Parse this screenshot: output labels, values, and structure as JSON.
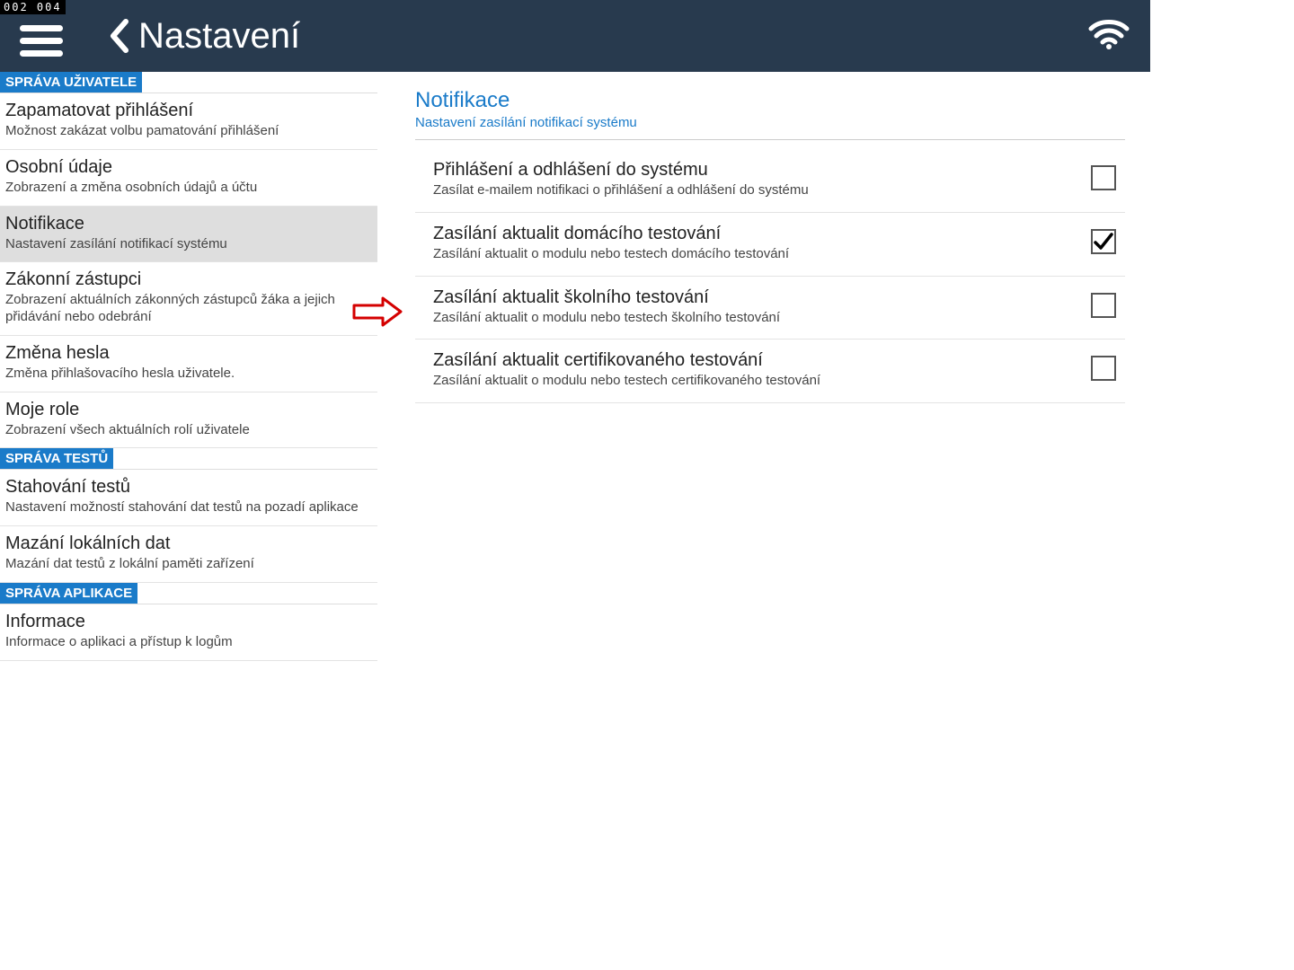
{
  "status_bar": {
    "time": "002  004"
  },
  "header": {
    "title": "Nastavení"
  },
  "sidebar": {
    "sections": [
      {
        "header": "SPRÁVA UŽIVATELE",
        "items": [
          {
            "title": "Zapamatovat přihlášení",
            "sub": "Možnost zakázat volbu pamatování přihlášení",
            "selected": false
          },
          {
            "title": "Osobní údaje",
            "sub": "Zobrazení a změna osobních údajů a účtu",
            "selected": false
          },
          {
            "title": "Notifikace",
            "sub": "Nastavení zasílání notifikací systému",
            "selected": true
          },
          {
            "title": "Zákonní zástupci",
            "sub": "Zobrazení aktuálních zákonných zástupců žáka a jejich přidávání nebo odebrání",
            "selected": false
          },
          {
            "title": "Změna hesla",
            "sub": "Změna přihlašovacího hesla uživatele.",
            "selected": false
          },
          {
            "title": "Moje role",
            "sub": "Zobrazení všech aktuálních rolí uživatele",
            "selected": false
          }
        ]
      },
      {
        "header": "SPRÁVA TESTŮ",
        "items": [
          {
            "title": "Stahování testů",
            "sub": "Nastavení možností stahování dat testů na pozadí aplikace",
            "selected": false
          },
          {
            "title": "Mazání lokálních dat",
            "sub": "Mazání dat testů z lokální paměti zařízení",
            "selected": false
          }
        ]
      },
      {
        "header": "SPRÁVA APLIKACE",
        "items": [
          {
            "title": "Informace",
            "sub": "Informace o aplikaci a přístup k logům",
            "selected": false
          }
        ]
      }
    ]
  },
  "main": {
    "title": "Notifikace",
    "subtitle": "Nastavení zasílání notifikací systému",
    "options": [
      {
        "title": "Přihlášení a odhlášení do systému",
        "sub": "Zasílat e-mailem notifikaci o přihlášení a odhlášení do systému",
        "checked": false
      },
      {
        "title": "Zasílání aktualit domácího testování",
        "sub": "Zasílání aktualit o modulu nebo testech domácího testování",
        "checked": true
      },
      {
        "title": "Zasílání aktualit školního testování",
        "sub": "Zasílání aktualit o modulu nebo testech školního testování",
        "checked": false
      },
      {
        "title": "Zasílání aktualit certifikovaného testování",
        "sub": "Zasílání aktualit o modulu nebo testech certifikovaného testování",
        "checked": false
      }
    ]
  }
}
